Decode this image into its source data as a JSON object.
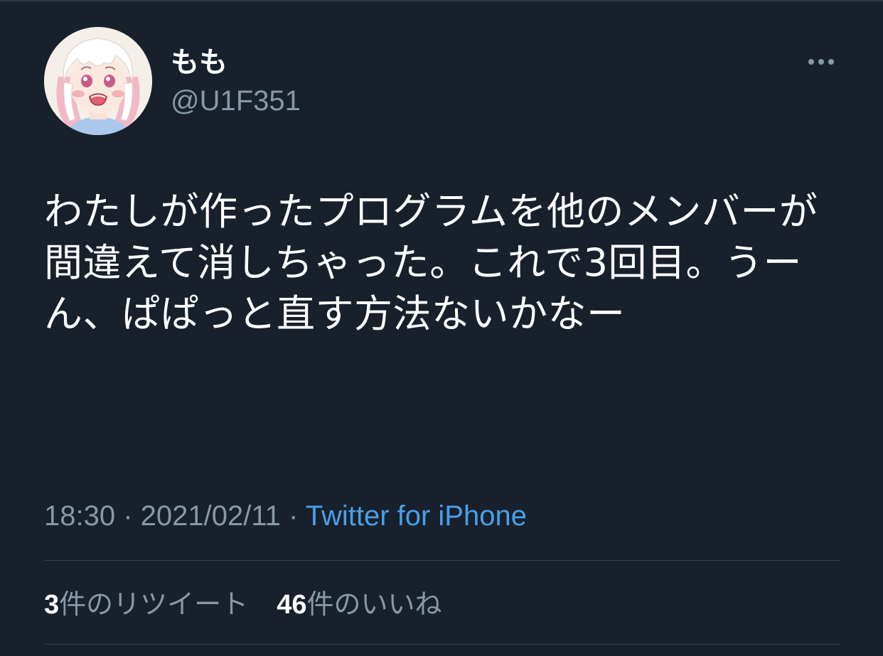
{
  "user": {
    "display_name": "もも",
    "handle": "@U1F351",
    "avatar_icon": "avatar-illustration"
  },
  "tweet": {
    "text": "わたしが作ったプログラムを他のメンバーが間違えて消しちゃった。これで3回目。うーん、ぱぱっと直す方法ないかなー",
    "time": "18:30",
    "date": "2021/02/11",
    "separator": " · ",
    "source": "Twitter for iPhone"
  },
  "stats": {
    "retweets_count": "3",
    "retweets_label": "件のリツイート",
    "likes_count": "46",
    "likes_label": "件のいいね"
  },
  "colors": {
    "background": "#17202b",
    "primary_text": "#ffffff",
    "secondary_text": "#8899a6",
    "link": "#4a9fe8",
    "divider": "#38444d"
  }
}
